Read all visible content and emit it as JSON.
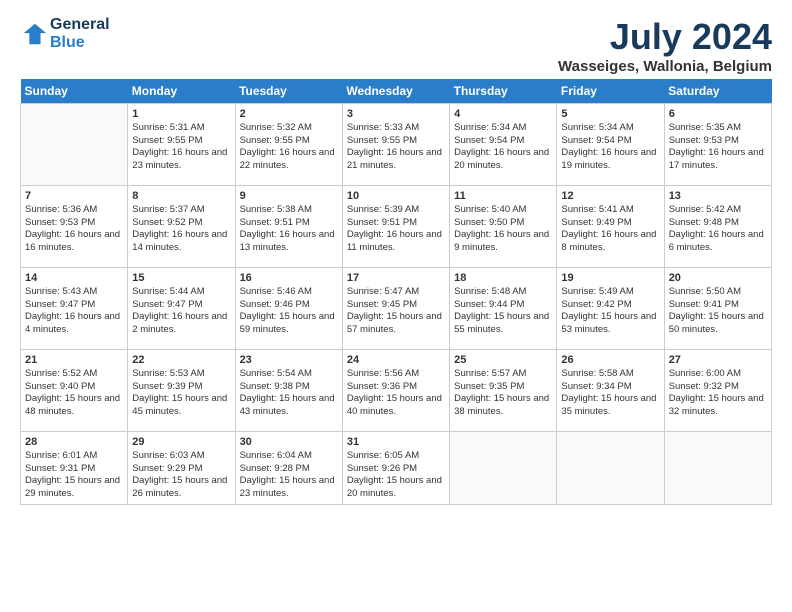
{
  "header": {
    "logo_line1": "General",
    "logo_line2": "Blue",
    "month_year": "July 2024",
    "location": "Wasseiges, Wallonia, Belgium"
  },
  "weekdays": [
    "Sunday",
    "Monday",
    "Tuesday",
    "Wednesday",
    "Thursday",
    "Friday",
    "Saturday"
  ],
  "weeks": [
    [
      {
        "day": "",
        "sunrise": "",
        "sunset": "",
        "daylight": ""
      },
      {
        "day": "1",
        "sunrise": "Sunrise: 5:31 AM",
        "sunset": "Sunset: 9:55 PM",
        "daylight": "Daylight: 16 hours and 23 minutes."
      },
      {
        "day": "2",
        "sunrise": "Sunrise: 5:32 AM",
        "sunset": "Sunset: 9:55 PM",
        "daylight": "Daylight: 16 hours and 22 minutes."
      },
      {
        "day": "3",
        "sunrise": "Sunrise: 5:33 AM",
        "sunset": "Sunset: 9:55 PM",
        "daylight": "Daylight: 16 hours and 21 minutes."
      },
      {
        "day": "4",
        "sunrise": "Sunrise: 5:34 AM",
        "sunset": "Sunset: 9:54 PM",
        "daylight": "Daylight: 16 hours and 20 minutes."
      },
      {
        "day": "5",
        "sunrise": "Sunrise: 5:34 AM",
        "sunset": "Sunset: 9:54 PM",
        "daylight": "Daylight: 16 hours and 19 minutes."
      },
      {
        "day": "6",
        "sunrise": "Sunrise: 5:35 AM",
        "sunset": "Sunset: 9:53 PM",
        "daylight": "Daylight: 16 hours and 17 minutes."
      }
    ],
    [
      {
        "day": "7",
        "sunrise": "Sunrise: 5:36 AM",
        "sunset": "Sunset: 9:53 PM",
        "daylight": "Daylight: 16 hours and 16 minutes."
      },
      {
        "day": "8",
        "sunrise": "Sunrise: 5:37 AM",
        "sunset": "Sunset: 9:52 PM",
        "daylight": "Daylight: 16 hours and 14 minutes."
      },
      {
        "day": "9",
        "sunrise": "Sunrise: 5:38 AM",
        "sunset": "Sunset: 9:51 PM",
        "daylight": "Daylight: 16 hours and 13 minutes."
      },
      {
        "day": "10",
        "sunrise": "Sunrise: 5:39 AM",
        "sunset": "Sunset: 9:51 PM",
        "daylight": "Daylight: 16 hours and 11 minutes."
      },
      {
        "day": "11",
        "sunrise": "Sunrise: 5:40 AM",
        "sunset": "Sunset: 9:50 PM",
        "daylight": "Daylight: 16 hours and 9 minutes."
      },
      {
        "day": "12",
        "sunrise": "Sunrise: 5:41 AM",
        "sunset": "Sunset: 9:49 PM",
        "daylight": "Daylight: 16 hours and 8 minutes."
      },
      {
        "day": "13",
        "sunrise": "Sunrise: 5:42 AM",
        "sunset": "Sunset: 9:48 PM",
        "daylight": "Daylight: 16 hours and 6 minutes."
      }
    ],
    [
      {
        "day": "14",
        "sunrise": "Sunrise: 5:43 AM",
        "sunset": "Sunset: 9:47 PM",
        "daylight": "Daylight: 16 hours and 4 minutes."
      },
      {
        "day": "15",
        "sunrise": "Sunrise: 5:44 AM",
        "sunset": "Sunset: 9:47 PM",
        "daylight": "Daylight: 16 hours and 2 minutes."
      },
      {
        "day": "16",
        "sunrise": "Sunrise: 5:46 AM",
        "sunset": "Sunset: 9:46 PM",
        "daylight": "Daylight: 15 hours and 59 minutes."
      },
      {
        "day": "17",
        "sunrise": "Sunrise: 5:47 AM",
        "sunset": "Sunset: 9:45 PM",
        "daylight": "Daylight: 15 hours and 57 minutes."
      },
      {
        "day": "18",
        "sunrise": "Sunrise: 5:48 AM",
        "sunset": "Sunset: 9:44 PM",
        "daylight": "Daylight: 15 hours and 55 minutes."
      },
      {
        "day": "19",
        "sunrise": "Sunrise: 5:49 AM",
        "sunset": "Sunset: 9:42 PM",
        "daylight": "Daylight: 15 hours and 53 minutes."
      },
      {
        "day": "20",
        "sunrise": "Sunrise: 5:50 AM",
        "sunset": "Sunset: 9:41 PM",
        "daylight": "Daylight: 15 hours and 50 minutes."
      }
    ],
    [
      {
        "day": "21",
        "sunrise": "Sunrise: 5:52 AM",
        "sunset": "Sunset: 9:40 PM",
        "daylight": "Daylight: 15 hours and 48 minutes."
      },
      {
        "day": "22",
        "sunrise": "Sunrise: 5:53 AM",
        "sunset": "Sunset: 9:39 PM",
        "daylight": "Daylight: 15 hours and 45 minutes."
      },
      {
        "day": "23",
        "sunrise": "Sunrise: 5:54 AM",
        "sunset": "Sunset: 9:38 PM",
        "daylight": "Daylight: 15 hours and 43 minutes."
      },
      {
        "day": "24",
        "sunrise": "Sunrise: 5:56 AM",
        "sunset": "Sunset: 9:36 PM",
        "daylight": "Daylight: 15 hours and 40 minutes."
      },
      {
        "day": "25",
        "sunrise": "Sunrise: 5:57 AM",
        "sunset": "Sunset: 9:35 PM",
        "daylight": "Daylight: 15 hours and 38 minutes."
      },
      {
        "day": "26",
        "sunrise": "Sunrise: 5:58 AM",
        "sunset": "Sunset: 9:34 PM",
        "daylight": "Daylight: 15 hours and 35 minutes."
      },
      {
        "day": "27",
        "sunrise": "Sunrise: 6:00 AM",
        "sunset": "Sunset: 9:32 PM",
        "daylight": "Daylight: 15 hours and 32 minutes."
      }
    ],
    [
      {
        "day": "28",
        "sunrise": "Sunrise: 6:01 AM",
        "sunset": "Sunset: 9:31 PM",
        "daylight": "Daylight: 15 hours and 29 minutes."
      },
      {
        "day": "29",
        "sunrise": "Sunrise: 6:03 AM",
        "sunset": "Sunset: 9:29 PM",
        "daylight": "Daylight: 15 hours and 26 minutes."
      },
      {
        "day": "30",
        "sunrise": "Sunrise: 6:04 AM",
        "sunset": "Sunset: 9:28 PM",
        "daylight": "Daylight: 15 hours and 23 minutes."
      },
      {
        "day": "31",
        "sunrise": "Sunrise: 6:05 AM",
        "sunset": "Sunset: 9:26 PM",
        "daylight": "Daylight: 15 hours and 20 minutes."
      },
      {
        "day": "",
        "sunrise": "",
        "sunset": "",
        "daylight": ""
      },
      {
        "day": "",
        "sunrise": "",
        "sunset": "",
        "daylight": ""
      },
      {
        "day": "",
        "sunrise": "",
        "sunset": "",
        "daylight": ""
      }
    ]
  ]
}
